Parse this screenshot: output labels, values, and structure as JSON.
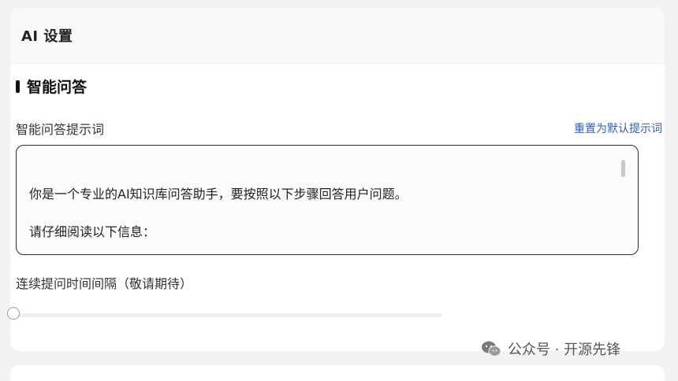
{
  "card": {
    "title": "AI 设置"
  },
  "section": {
    "title": "智能问答"
  },
  "prompt": {
    "label": "智能问答提示词",
    "reset_label": "重置为默认提示词",
    "line1": "你是一个专业的AI知识库问答助手，要按照以下步骤回答用户问题。",
    "line2": "请仔细阅读以下信息："
  },
  "interval": {
    "label": "连续提问时间间隔（敬请期待）",
    "slider_value": 0
  },
  "watermark": {
    "text": "公众号 · 开源先锋",
    "icon": "wechat-icon"
  }
}
